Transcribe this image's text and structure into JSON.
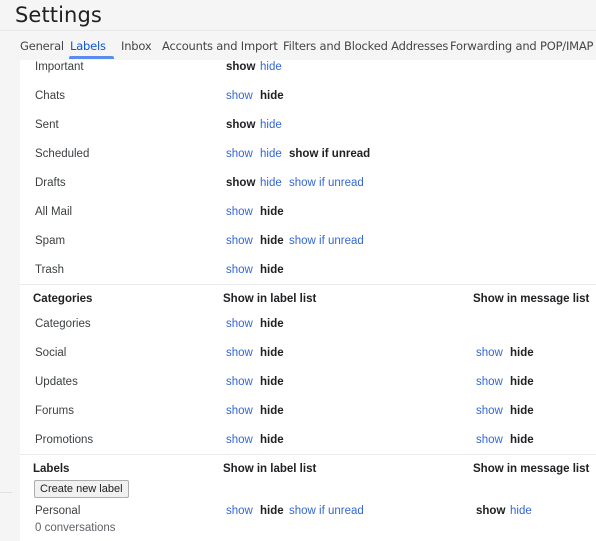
{
  "page": {
    "title": "Settings"
  },
  "tabs": [
    {
      "label": "General",
      "active": false
    },
    {
      "label": "Labels",
      "active": true
    },
    {
      "label": "Inbox",
      "active": false
    },
    {
      "label": "Accounts and Import",
      "active": false
    },
    {
      "label": "Filters and Blocked Addresses",
      "active": false
    },
    {
      "label": "Forwarding and POP/IMAP",
      "active": false
    }
  ],
  "system_labels": [
    {
      "name": "Important",
      "show": "show",
      "hide": "hide",
      "selected": "show"
    },
    {
      "name": "Chats",
      "show": "show",
      "hide": "hide",
      "selected": "hide"
    },
    {
      "name": "Sent",
      "show": "show",
      "hide": "hide",
      "selected": "show"
    },
    {
      "name": "Scheduled",
      "show": "show",
      "hide": "hide",
      "unread": "show if unread",
      "selected": "show if unread"
    },
    {
      "name": "Drafts",
      "show": "show",
      "hide": "hide",
      "unread": "show if unread",
      "selected": "show"
    },
    {
      "name": "All Mail",
      "show": "show",
      "hide": "hide",
      "selected": "hide"
    },
    {
      "name": "Spam",
      "show": "show",
      "hide": "hide",
      "unread": "show if unread",
      "selected": "hide"
    },
    {
      "name": "Trash",
      "show": "show",
      "hide": "hide",
      "selected": "hide"
    }
  ],
  "categories_section": {
    "header": "Categories",
    "col_label_list": "Show in label list",
    "col_message_list": "Show in message list",
    "rows": [
      {
        "name": "Categories",
        "label_list": {
          "show": "show",
          "hide": "hide",
          "selected": "hide"
        }
      },
      {
        "name": "Social",
        "label_list": {
          "show": "show",
          "hide": "hide",
          "selected": "hide"
        },
        "message_list": {
          "show": "show",
          "hide": "hide",
          "selected": "hide"
        }
      },
      {
        "name": "Updates",
        "label_list": {
          "show": "show",
          "hide": "hide",
          "selected": "hide"
        },
        "message_list": {
          "show": "show",
          "hide": "hide",
          "selected": "hide"
        }
      },
      {
        "name": "Forums",
        "label_list": {
          "show": "show",
          "hide": "hide",
          "selected": "hide"
        },
        "message_list": {
          "show": "show",
          "hide": "hide",
          "selected": "hide"
        }
      },
      {
        "name": "Promotions",
        "label_list": {
          "show": "show",
          "hide": "hide",
          "selected": "hide"
        },
        "message_list": {
          "show": "show",
          "hide": "hide",
          "selected": "hide"
        }
      }
    ]
  },
  "labels_section": {
    "header": "Labels",
    "col_label_list": "Show in label list",
    "col_message_list": "Show in message list",
    "create_button": "Create new label",
    "rows": [
      {
        "name": "Personal",
        "count": "0 conversations",
        "label_list": {
          "show": "show",
          "hide": "hide",
          "unread": "show if unread",
          "selected": "hide"
        },
        "message_list": {
          "show": "show",
          "hide": "hide",
          "selected": "show"
        }
      }
    ]
  },
  "colors": {
    "link": "#3367d6",
    "active_tab": "#0b57d0",
    "tab_underline": "#5b8def"
  }
}
